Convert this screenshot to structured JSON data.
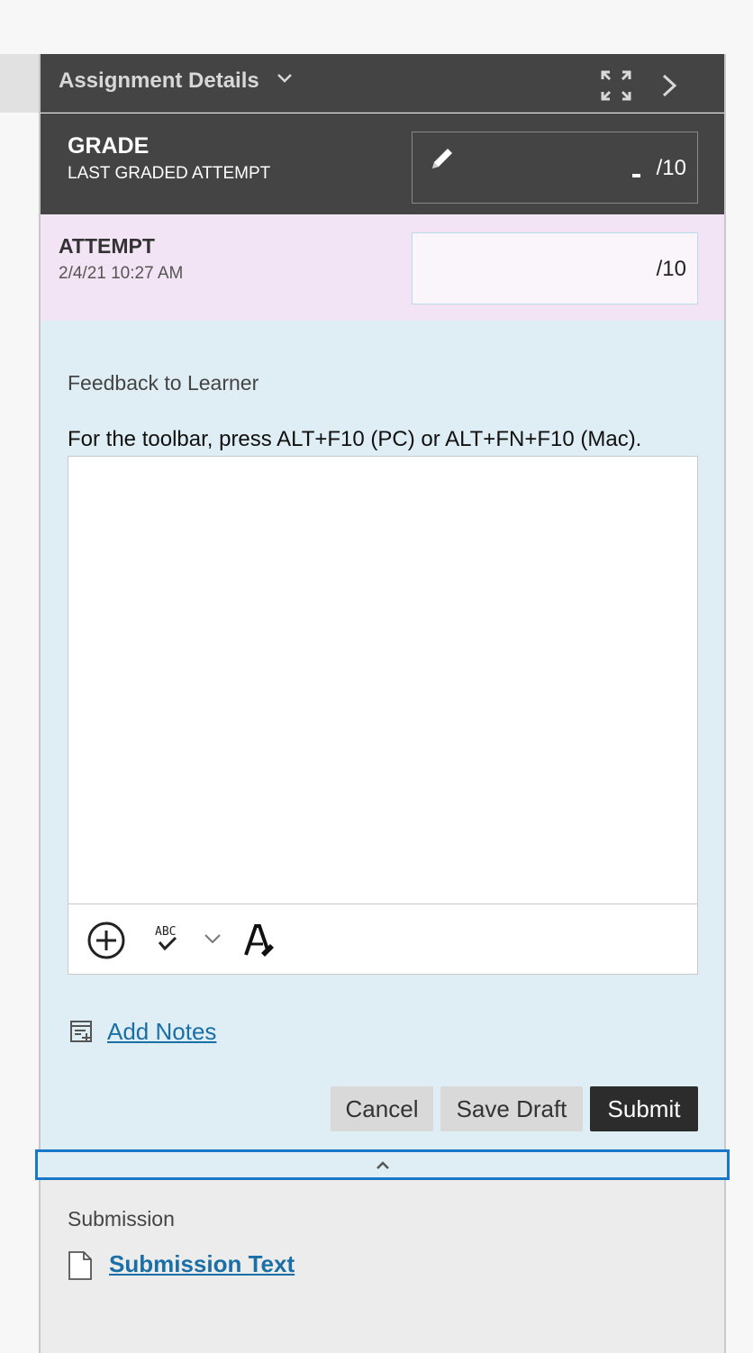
{
  "header": {
    "title": "Assignment Details",
    "title_dropdown_icon": "chevron-down-icon",
    "expand_icon": "fullscreen-expand-icon",
    "next_icon": "chevron-right-icon"
  },
  "grade": {
    "title": "GRADE",
    "subtitle": "LAST GRADED ATTEMPT",
    "edit_icon": "pencil-icon",
    "value": "/10"
  },
  "attempt": {
    "title": "ATTEMPT",
    "date": "2/4/21 10:27 AM",
    "value": "/10"
  },
  "feedback": {
    "label": "Feedback to Learner",
    "toolbar_hint": "For the toolbar, press ALT+F10 (PC) or ALT+FN+F10 (Mac).",
    "editor_value": "",
    "toolbar": {
      "add_icon": "plus-circle-icon",
      "spellcheck_icon": "spellcheck-icon",
      "dropdown_icon": "chevron-down-icon",
      "format_icon": "text-format-icon"
    }
  },
  "notes": {
    "label": "Add Notes",
    "icon": "notes-icon"
  },
  "actions": {
    "cancel": "Cancel",
    "save_draft": "Save Draft",
    "submit": "Submit"
  },
  "collapse": {
    "icon": "chevron-up-icon"
  },
  "submission": {
    "label": "Submission",
    "link": "Submission Text",
    "icon": "document-icon"
  },
  "colors": {
    "header_bg": "#444444",
    "attempt_bg": "#f2e4f4",
    "feedback_bg": "#dfeef4",
    "link": "#1a6fa6",
    "focus_outline": "#1977c9"
  }
}
